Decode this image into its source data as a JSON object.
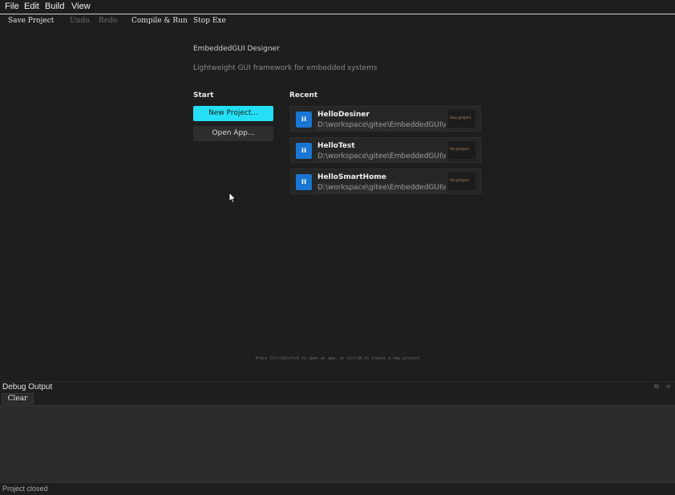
{
  "menu": [
    "File",
    "Edit",
    "Build",
    "View"
  ],
  "toolbar": {
    "save_project": "Save Project",
    "undo": "Undo",
    "redo": "Redo",
    "compile_run": "Compile & Run",
    "stop_exe": "Stop Exe"
  },
  "welcome": {
    "title": "EmbeddedGUI Designer",
    "subtitle": "Lightweight GUI framework for embedded systems",
    "start_heading": "Start",
    "recent_heading": "Recent",
    "new_project": "New Project...",
    "open_app": "Open App...",
    "recent": [
      {
        "icon": "H",
        "name": "HelloDesiner",
        "path": "D:\\workspace\\gitee\\EmbeddedGUI\\example\\HelloDesiner",
        "status": "Has project"
      },
      {
        "icon": "H",
        "name": "HelloTest",
        "path": "D:\\workspace\\gitee\\EmbeddedGUI\\example\\HelloTest",
        "status": "No project"
      },
      {
        "icon": "H",
        "name": "HelloSmartHome",
        "path": "D:\\workspace\\gitee\\EmbeddedGUI\\example\\HelloSmartHome",
        "status": "No project"
      }
    ],
    "hint": "Press Ctrl+Shift+O to open an app, or Ctrl+N to create a new project"
  },
  "debug": {
    "title": "Debug Output",
    "clear": "Clear",
    "float_icon": "⧉",
    "close_icon": "×"
  },
  "status": {
    "text": "Project closed"
  },
  "colors": {
    "accent": "#25e0f4",
    "recent_icon": "#1976d2",
    "background": "#1e1e1e"
  }
}
